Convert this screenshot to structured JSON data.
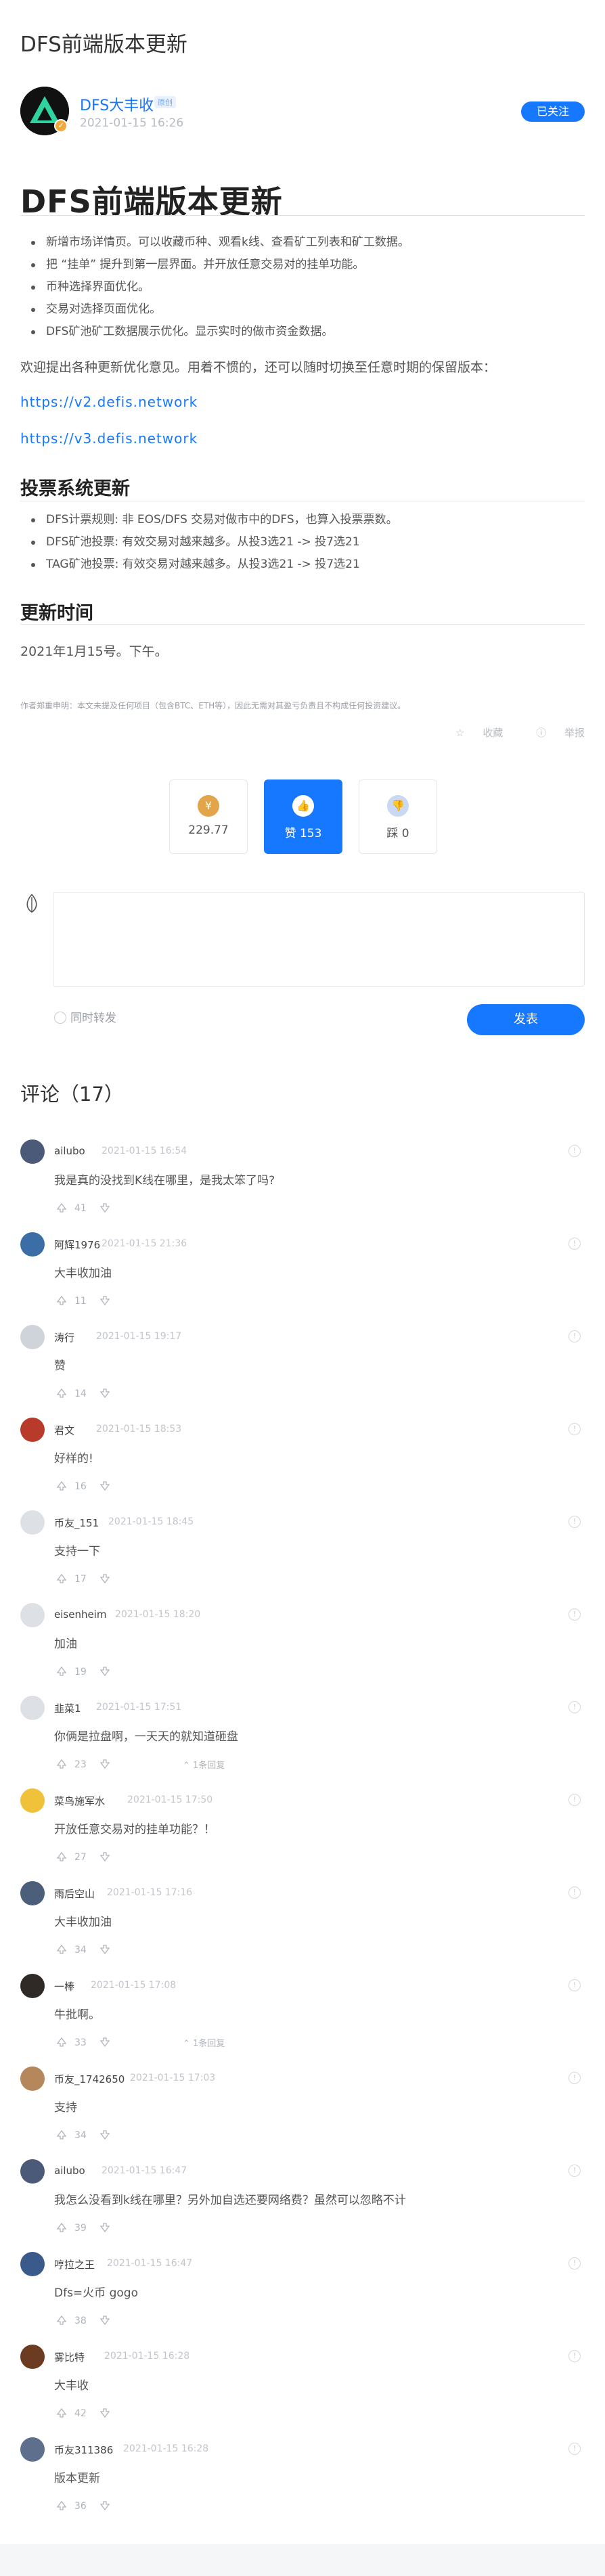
{
  "page": {
    "top_title": "DFS前端版本更新"
  },
  "author": {
    "name": "DFS大丰收",
    "tag": "原创",
    "date": "2021-01-15 16:26",
    "follow_label": "已关注"
  },
  "article": {
    "title": "DFS前端版本更新",
    "bullets1": [
      "新增市场详情页。可以收藏币种、观看k线、查看矿工列表和矿工数据。",
      "把 “挂单” 提升到第一层界面。并开放任意交易对的挂单功能。",
      "币种选择界面优化。",
      "交易对选择页面优化。",
      "DFS矿池矿工数据展示优化。显示实时的做市资金数据。"
    ],
    "intro": "欢迎提出各种更新优化意见。用着不惯的，还可以随时切换至任意时期的保留版本：",
    "link1": "https://v2.defis.network",
    "link2": "https://v3.defis.network",
    "h2_vote": "投票系统更新",
    "bullets2": [
      "DFS计票规则: 非 EOS/DFS 交易对做市中的DFS，也算入投票票数。",
      "DFS矿池投票: 有效交易对越来越多。从投3选21 -> 投7选21",
      "TAG矿池投票: 有效交易对越来越多。从投3选21 -> 投7选21"
    ],
    "h2_time": "更新时间",
    "update_time": "2021年1月15号。下午。",
    "disclaimer": "作者郑重申明：本文未提及任何项目（包含BTC、ETH等），因此无需对其盈亏负责且不构成任何投资建议。",
    "favorite_label": "收藏",
    "report_label": "举报"
  },
  "votes": {
    "reward_value": "229.77",
    "like_label": "赞 153",
    "dislike_label": "踩 0",
    "reward_color": "#e2a54a",
    "like_color": "#1677ff"
  },
  "composer": {
    "repost_label": "同时转发",
    "publish_label": "发表"
  },
  "comments_title": "评论（17）",
  "comments": [
    {
      "user": "ailubo",
      "date": "2021-01-15 16:54",
      "text": "我是真的没找到K线在哪里，是我太笨了吗?",
      "likes": "41",
      "avatar_color": "#4a5a78",
      "reply": ""
    },
    {
      "user": "阿辉1976",
      "date": "2021-01-15 21:36",
      "text": "大丰收加油",
      "likes": "11",
      "avatar_color": "#3a6ea5",
      "reply": ""
    },
    {
      "user": "涛行",
      "date": "2021-01-15 19:17",
      "text": "赞",
      "likes": "14",
      "avatar_color": "#cfd4db",
      "reply": ""
    },
    {
      "user": "君文",
      "date": "2021-01-15 18:53",
      "text": "好样的!",
      "likes": "16",
      "avatar_color": "#b83a2a",
      "reply": ""
    },
    {
      "user": "币友_151",
      "date": "2021-01-15 18:45",
      "text": "支持一下",
      "likes": "17",
      "avatar_color": "#dde1e6",
      "reply": ""
    },
    {
      "user": "eisenheim",
      "date": "2021-01-15 18:20",
      "text": "加油",
      "likes": "19",
      "avatar_color": "#dde1e6",
      "reply": ""
    },
    {
      "user": "韭菜1",
      "date": "2021-01-15 17:51",
      "text": "你俩是拉盘啊，一天天的就知道砸盘",
      "likes": "23",
      "avatar_color": "#dde1e6",
      "reply": "1条回复"
    },
    {
      "user": "菜鸟施军水",
      "date": "2021-01-15 17:50",
      "text": "开放任意交易对的挂单功能？！",
      "likes": "27",
      "avatar_color": "#f0c23a",
      "reply": ""
    },
    {
      "user": "雨后空山",
      "date": "2021-01-15 17:16",
      "text": "大丰收加油",
      "likes": "34",
      "avatar_color": "#4b5f7a",
      "reply": ""
    },
    {
      "user": "一棒",
      "date": "2021-01-15 17:08",
      "text": "牛批啊。",
      "likes": "33",
      "avatar_color": "#2f2a26",
      "reply": "1条回复"
    },
    {
      "user": "币友_1742650",
      "date": "2021-01-15 17:03",
      "text": "支持",
      "likes": "34",
      "avatar_color": "#b6875a",
      "reply": ""
    },
    {
      "user": "ailubo",
      "date": "2021-01-15 16:47",
      "text": "我怎么没看到k线在哪里？另外加自选还要网络费？虽然可以忽略不计",
      "likes": "39",
      "avatar_color": "#4a5a78",
      "reply": ""
    },
    {
      "user": "哼拉之王",
      "date": "2021-01-15 16:47",
      "text": "Dfs=火币 gogo",
      "likes": "38",
      "avatar_color": "#3b5a8c",
      "reply": ""
    },
    {
      "user": "雾比特",
      "date": "2021-01-15 16:28",
      "text": "大丰收",
      "likes": "42",
      "avatar_color": "#6b3b22",
      "reply": ""
    },
    {
      "user": "币友311386",
      "date": "2021-01-15 16:28",
      "text": "版本更新",
      "likes": "36",
      "avatar_color": "#5d6f8c",
      "reply": ""
    }
  ]
}
